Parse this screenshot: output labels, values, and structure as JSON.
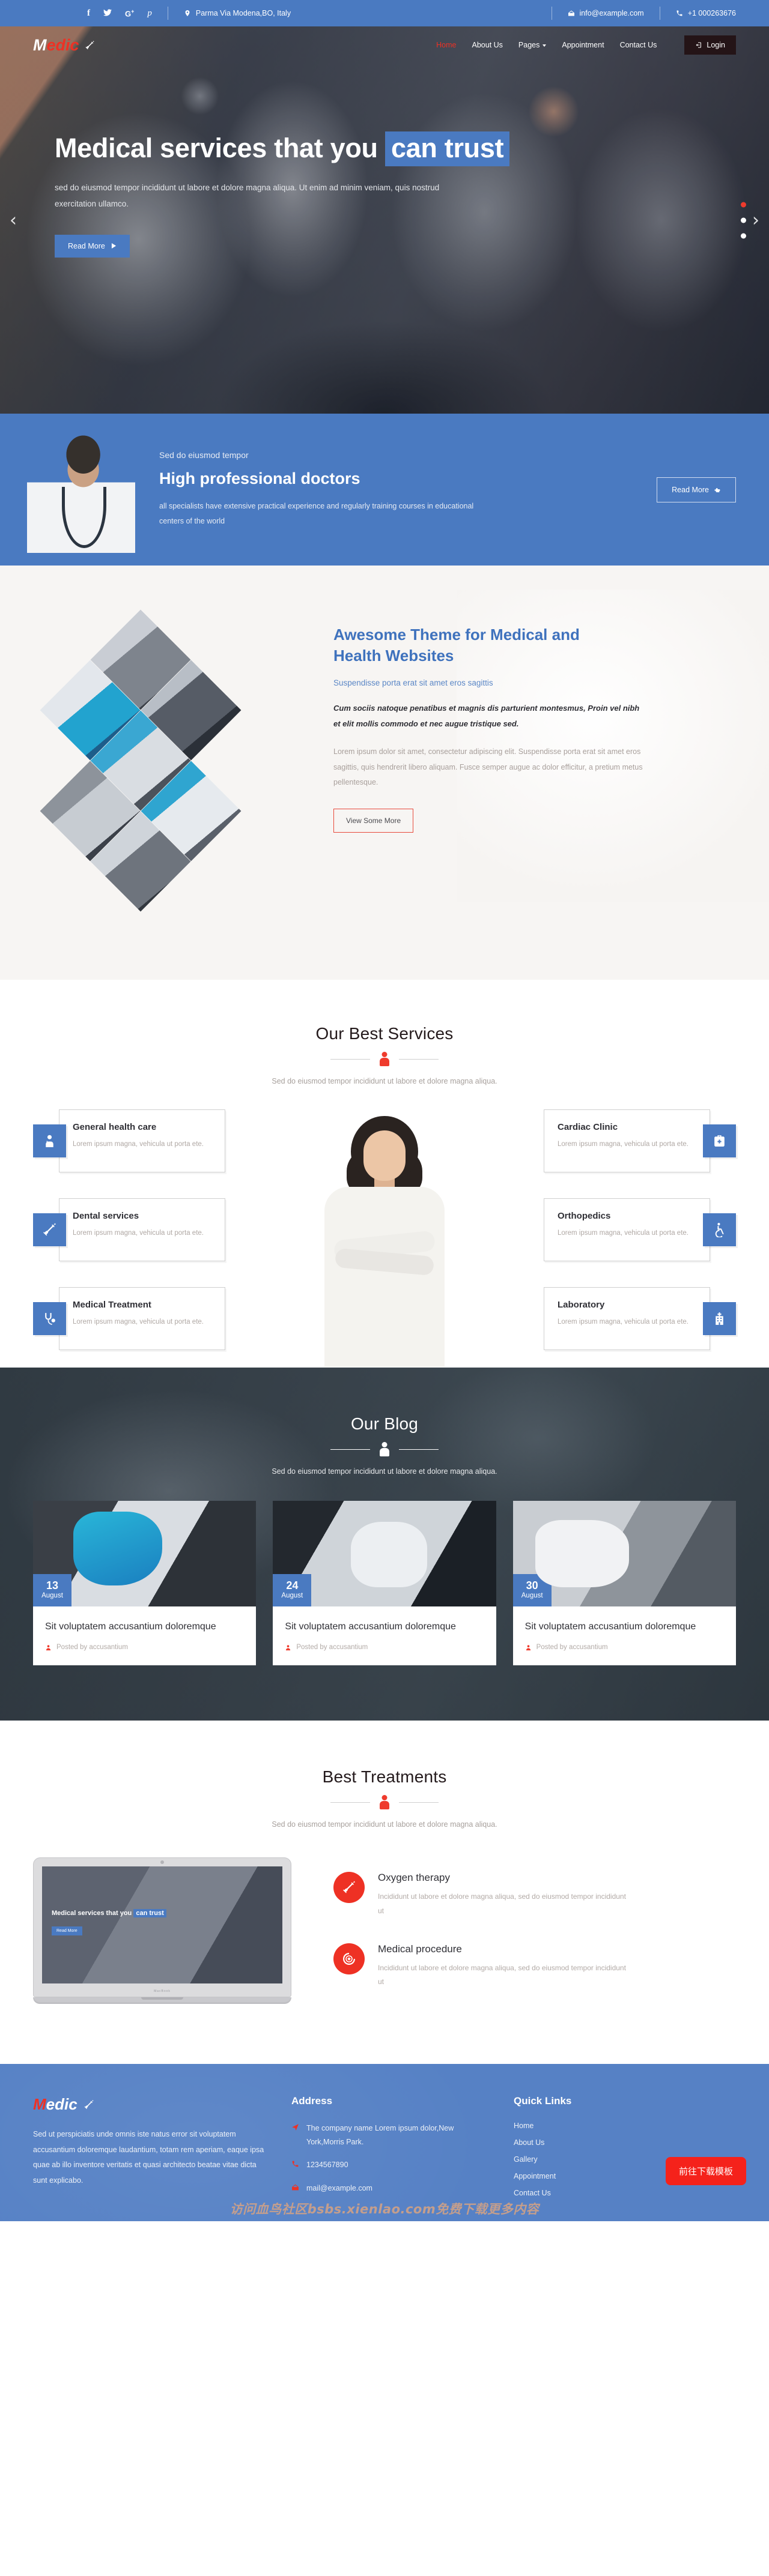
{
  "topbar": {
    "social": [
      {
        "name": "facebook-icon",
        "glyph": "f"
      },
      {
        "name": "twitter-icon",
        "glyph": "✈"
      },
      {
        "name": "google-plus-icon",
        "glyph": "G+"
      },
      {
        "name": "pinterest-icon",
        "glyph": "ᴩ"
      }
    ],
    "address": "Parma Via Modena,BO, Italy",
    "email": "info@example.com",
    "phone": "+1 000263676"
  },
  "nav": {
    "logo_first": "M",
    "logo_rest": "edic",
    "links": [
      {
        "label": "Home",
        "active": true
      },
      {
        "label": "About Us",
        "active": false
      },
      {
        "label": "Pages",
        "active": false,
        "dropdown": true
      },
      {
        "label": "Appointment",
        "active": false
      },
      {
        "label": "Contact Us",
        "active": false
      }
    ],
    "login_label": "Login"
  },
  "hero": {
    "title_part1": "Medical services that you",
    "title_highlight": "can trust",
    "paragraph": "sed do eiusmod tempor incididunt ut labore et dolore magna aliqua. Ut enim ad minim veniam, quis nostrud exercitation ullamco.",
    "button": "Read More",
    "prev_arrow": "‹",
    "next_arrow": "›",
    "dots": 3,
    "active_dot": 0
  },
  "doctors": {
    "eyebrow": "Sed do eiusmod tempor",
    "title": "High professional doctors",
    "paragraph": "all specialists have extensive practical experience and regularly training courses in educational centers of the world",
    "button": "Read More"
  },
  "about": {
    "title": "Awesome Theme for Medical and Health Websites",
    "subtitle": "Suspendisse porta erat sit amet eros sagittis",
    "lead": "Cum sociis natoque penatibus et magnis dis parturient montesmus, Proin vel nibh et elit mollis commodo et nec augue tristique sed.",
    "body": "Lorem ipsum dolor sit amet, consectetur adipiscing elit. Suspendisse porta erat sit amet eros sagittis, quis hendrerit libero aliquam. Fusce semper augue ac dolor efficitur, a pretium metus pellentesque.",
    "button": "View Some More"
  },
  "services": {
    "heading": "Our Best Services",
    "subheading": "Sed do eiusmod tempor incididunt ut labore et dolore magna aliqua.",
    "left": [
      {
        "title": "General health care",
        "text": "Lorem ipsum magna, vehicula ut porta ete.",
        "icon": "doctor-icon"
      },
      {
        "title": "Dental services",
        "text": "Lorem ipsum magna, vehicula ut porta ete.",
        "icon": "syringe-icon"
      },
      {
        "title": "Medical Treatment",
        "text": "Lorem ipsum magna, vehicula ut porta ete.",
        "icon": "stethoscope-icon"
      }
    ],
    "right": [
      {
        "title": "Cardiac Clinic",
        "text": "Lorem ipsum magna, vehicula ut porta ete.",
        "icon": "medical-bag-icon"
      },
      {
        "title": "Orthopedics",
        "text": "Lorem ipsum magna, vehicula ut porta ete.",
        "icon": "wheelchair-icon"
      },
      {
        "title": "Laboratory",
        "text": "Lorem ipsum magna, vehicula ut porta ete.",
        "icon": "hospital-icon"
      }
    ]
  },
  "blog": {
    "heading": "Our Blog",
    "subheading": "Sed do eiusmod tempor incididunt ut labore et dolore magna aliqua.",
    "posts": [
      {
        "day": "13",
        "month": "August",
        "title": "Sit voluptatem accusantium doloremque",
        "meta": "Posted by accusantium"
      },
      {
        "day": "24",
        "month": "August",
        "title": "Sit voluptatem accusantium doloremque",
        "meta": "Posted by accusantium"
      },
      {
        "day": "30",
        "month": "August",
        "title": "Sit voluptatem accusantium doloremque",
        "meta": "Posted by accusantium"
      }
    ]
  },
  "treatments": {
    "heading": "Best Treatments",
    "subheading": "Sed do eiusmod tempor incididunt ut labore et dolore magna aliqua.",
    "laptop_caption_part1": "Medical services that you",
    "laptop_caption_highlight": "can trust",
    "laptop_button": "Read More",
    "laptop_brand": "MacBook",
    "items": [
      {
        "title": "Oxygen therapy",
        "text": "Incididunt ut labore et dolore magna aliqua, sed do eiusmod tempor incididunt ut",
        "icon": "syringe-icon"
      },
      {
        "title": "Medical procedure",
        "text": "Incididunt ut labore et dolore magna aliqua, sed do eiusmod tempor incididunt ut",
        "icon": "medical-shield-icon"
      }
    ]
  },
  "footer": {
    "logo_first": "M",
    "logo_rest": "edic",
    "about": "Sed ut perspiciatis unde omnis iste natus error sit voluptatem accusantium doloremque laudantium, totam rem aperiam, eaque ipsa quae ab illo inventore veritatis et quasi architecto beatae vitae dicta sunt explicabo.",
    "address_heading": "Address",
    "address_line": "The company name Lorem ipsum dolor,New York,Morris Park.",
    "phone": "1234567890",
    "email": "mail@example.com",
    "links_heading": "Quick Links",
    "links": [
      "Home",
      "About Us",
      "Gallery",
      "Appointment",
      "Contact Us"
    ],
    "cta_button": "前往下载模板",
    "watermark": "访问血鸟社区bsbs.xienlao.com免费下载更多内容"
  },
  "colors": {
    "primary_blue": "#4a7ac1",
    "accent_red": "#ee3124",
    "footer_blue": "#5681c5",
    "dark": "#241a1c"
  }
}
